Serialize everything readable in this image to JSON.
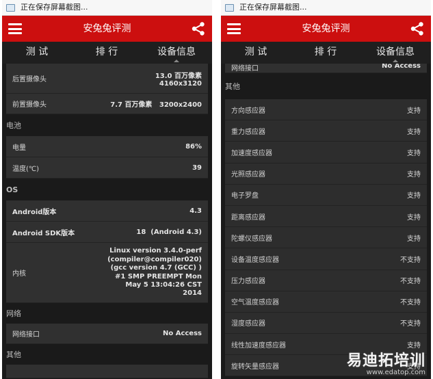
{
  "status_bar": {
    "text": "正在保存屏幕截图..."
  },
  "app_bar": {
    "title": "安兔兔评测"
  },
  "tabs": [
    "测 试",
    "排 行",
    "设备信息"
  ],
  "left": {
    "camera_rear": {
      "label": "后置摄像头",
      "value_line1": "13.0 百万像素",
      "value_line2": "4160x3120"
    },
    "camera_front": {
      "label": "前置摄像头",
      "value": "7.7 百万像素   3200x2400"
    },
    "battery_header": "电池",
    "battery_level": {
      "label": "电量",
      "value": "86%"
    },
    "battery_temp": {
      "label": "温度(℃)",
      "value": "39"
    },
    "os_header": "OS",
    "android_version": {
      "label": "Android版本",
      "value": "4.3"
    },
    "android_sdk": {
      "label": "Android SDK版本",
      "value": "18  (Android 4.3)"
    },
    "kernel": {
      "label": "内核",
      "lines": [
        "Linux version 3.4.0-perf",
        "(compiler@compiler020)",
        "(gcc version 4.7 (GCC) )",
        "#1 SMP PREEMPT Mon",
        "May 5 13:04:26 CST",
        "2014"
      ]
    },
    "network_header": "网络",
    "network_interface": {
      "label": "网络接口",
      "value": "No Access"
    },
    "other_header": "其他"
  },
  "right": {
    "network_interface": {
      "label": "网络接口",
      "value": "No Access"
    },
    "other_header": "其他",
    "sensors": [
      {
        "label": "方向感应器",
        "value": "支持"
      },
      {
        "label": "重力感应器",
        "value": "支持"
      },
      {
        "label": "加速度感应器",
        "value": "支持"
      },
      {
        "label": "光照感应器",
        "value": "支持"
      },
      {
        "label": "电子罗盘",
        "value": "支持"
      },
      {
        "label": "距离感应器",
        "value": "支持"
      },
      {
        "label": "陀螺仪感应器",
        "value": "支持"
      },
      {
        "label": "设备温度感应器",
        "value": "不支持"
      },
      {
        "label": "压力感应器",
        "value": "不支持"
      },
      {
        "label": "空气温度感应器",
        "value": "不支持"
      },
      {
        "label": "湿度感应器",
        "value": "不支持"
      },
      {
        "label": "线性加速度感应器",
        "value": "支持"
      },
      {
        "label": "旋转矢量感应器",
        "value": "支持"
      }
    ]
  },
  "watermark": {
    "brand": "易迪拓培训",
    "url": "www.edatop.com"
  },
  "colors": {
    "app_bar": "#cc0f0f",
    "row_bg": "#303030",
    "page_bg": "#1a1a1a"
  }
}
